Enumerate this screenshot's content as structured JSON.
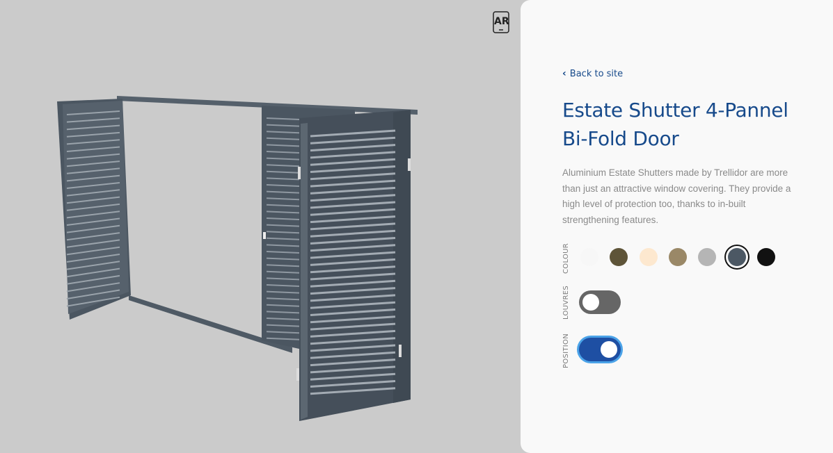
{
  "viewer": {
    "ar_label": "AR"
  },
  "panel": {
    "back_label": "Back to site",
    "title_line1": "Estate Shutter 4-Pannel",
    "title_line2": "Bi-Fold Door",
    "description": "Aluminium Estate Shutters made by Trellidor are more than just an attractive window covering. They provide a high level of protection too, thanks to in-built strengthening features.",
    "options": {
      "colour_label": "COLOUR",
      "louvres_label": "LOUVRES",
      "position_label": "POSITION",
      "louvres_on": false,
      "position_on": true
    },
    "colours": [
      "#f7f7f7",
      "#5e5438",
      "#fde8cf",
      "#9a8867",
      "#b5b5b5",
      "#4c5864",
      "#111111"
    ],
    "selected_colour": "#4c5864",
    "colors": {
      "accent": "#174a8b",
      "toggle_on": "#1e4fa3",
      "toggle_off": "#666666",
      "frame": "#4b5661"
    }
  }
}
